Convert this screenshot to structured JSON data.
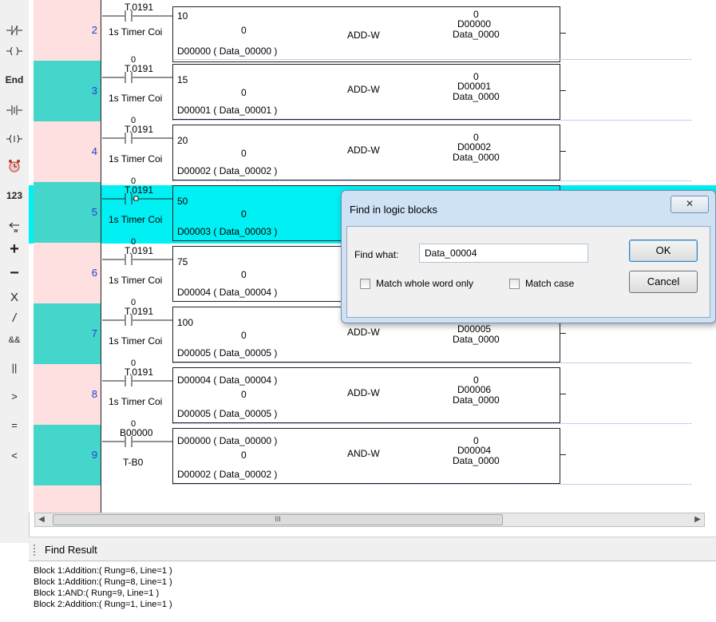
{
  "toolbar": {
    "items": [
      {
        "name": "nc-contact-icon",
        "label": ""
      },
      {
        "name": "coil-icon",
        "label": ""
      },
      {
        "name": "end-instruction",
        "label": "End"
      },
      {
        "name": "positive-transition-icon",
        "label": ""
      },
      {
        "name": "set-coil-icon",
        "label": ""
      },
      {
        "name": "timer-icon",
        "label": ""
      },
      {
        "name": "constant-number",
        "label": "123"
      },
      {
        "name": "move-word-icon",
        "label": ""
      },
      {
        "name": "add-instruction",
        "label": "+"
      },
      {
        "name": "subtract-instruction",
        "label": "−"
      },
      {
        "name": "multiply-instruction",
        "label": "X"
      },
      {
        "name": "divide-instruction",
        "label": "/"
      },
      {
        "name": "and-instruction",
        "label": "&&"
      },
      {
        "name": "or-instruction",
        "label": "||"
      },
      {
        "name": "greater-than-instruction",
        "label": ">"
      },
      {
        "name": "equal-instruction",
        "label": "="
      },
      {
        "name": "less-than-instruction",
        "label": "<"
      }
    ]
  },
  "ladder": {
    "rungs": [
      {
        "number": "2",
        "contact_zero": "",
        "contact_tag": "T.0191",
        "contact_sub": "1s Timer Coi",
        "in1": "10",
        "mid": "0",
        "in2": "D00000 ( Data_00000 )",
        "op": "ADD-W",
        "out_zero": "0",
        "out_reg": "D00000",
        "out_label": "Data_0000"
      },
      {
        "number": "3",
        "contact_zero": "0",
        "contact_tag": "T.0191",
        "contact_sub": "1s Timer Coi",
        "in1": "15",
        "mid": "0",
        "in2": "D00001 ( Data_00001 )",
        "op": "ADD-W",
        "out_zero": "0",
        "out_reg": "D00001",
        "out_label": "Data_0000"
      },
      {
        "number": "4",
        "contact_zero": "0",
        "contact_tag": "T.0191",
        "contact_sub": "1s Timer Coi",
        "in1": "20",
        "mid": "0",
        "in2": "D00002 ( Data_00002 )",
        "op": "ADD-W",
        "out_zero": "0",
        "out_reg": "D00002",
        "out_label": "Data_0000"
      },
      {
        "number": "5",
        "contact_zero": "0",
        "contact_tag": "T.0191",
        "contact_sub": "1s Timer Coi",
        "in1": "50",
        "mid": "0",
        "in2": "D00003 ( Data_00003 )",
        "op": "",
        "out_zero": "",
        "out_reg": "",
        "out_label": ""
      },
      {
        "number": "6",
        "contact_zero": "0",
        "contact_tag": "T.0191",
        "contact_sub": "1s Timer Coi",
        "in1": "75",
        "mid": "0",
        "in2": "D00004 ( Data_00004 )",
        "op": "",
        "out_zero": "",
        "out_reg": "",
        "out_label": ""
      },
      {
        "number": "7",
        "contact_zero": "0",
        "contact_tag": "T.0191",
        "contact_sub": "1s Timer Coi",
        "in1": "100",
        "mid": "0",
        "in2": "D00005 ( Data_00005 )",
        "op": "ADD-W",
        "out_zero": "0",
        "out_reg": "D00005",
        "out_label": "Data_0000"
      },
      {
        "number": "8",
        "contact_zero": "0",
        "contact_tag": "T.0191",
        "contact_sub": "1s Timer Coi",
        "in1": "D00004 ( Data_00004 )",
        "mid": "0",
        "in2": "D00005 ( Data_00005 )",
        "op": "ADD-W",
        "out_zero": "0",
        "out_reg": "D00006",
        "out_label": "Data_0000"
      },
      {
        "number": "9",
        "contact_zero": "0",
        "contact_tag": "B00000",
        "contact_sub": "T-B0",
        "in1": "D00000 ( Data_00000 )",
        "mid": "0",
        "in2": "D00002 ( Data_00002 )",
        "op": "AND-W",
        "out_zero": "0",
        "out_reg": "D00004",
        "out_label": "Data_0000"
      }
    ]
  },
  "find_dialog": {
    "title": "Find in logic blocks",
    "close": "✕",
    "find_label": "Find what:",
    "find_value": "Data_00004",
    "match_whole": "Match whole word only",
    "match_case": "Match case",
    "ok": "OK",
    "cancel": "Cancel"
  },
  "scrollbar": {
    "grip": "III"
  },
  "find_result": {
    "title": "Find Result",
    "results": [
      "Block 1:Addition:( Rung=6, Line=1 )",
      "Block 1:Addition:( Rung=8, Line=1 )",
      "Block 1:AND:( Rung=9, Line=1 )",
      "Block 2:Addition:( Rung=1, Line=1 )"
    ]
  }
}
